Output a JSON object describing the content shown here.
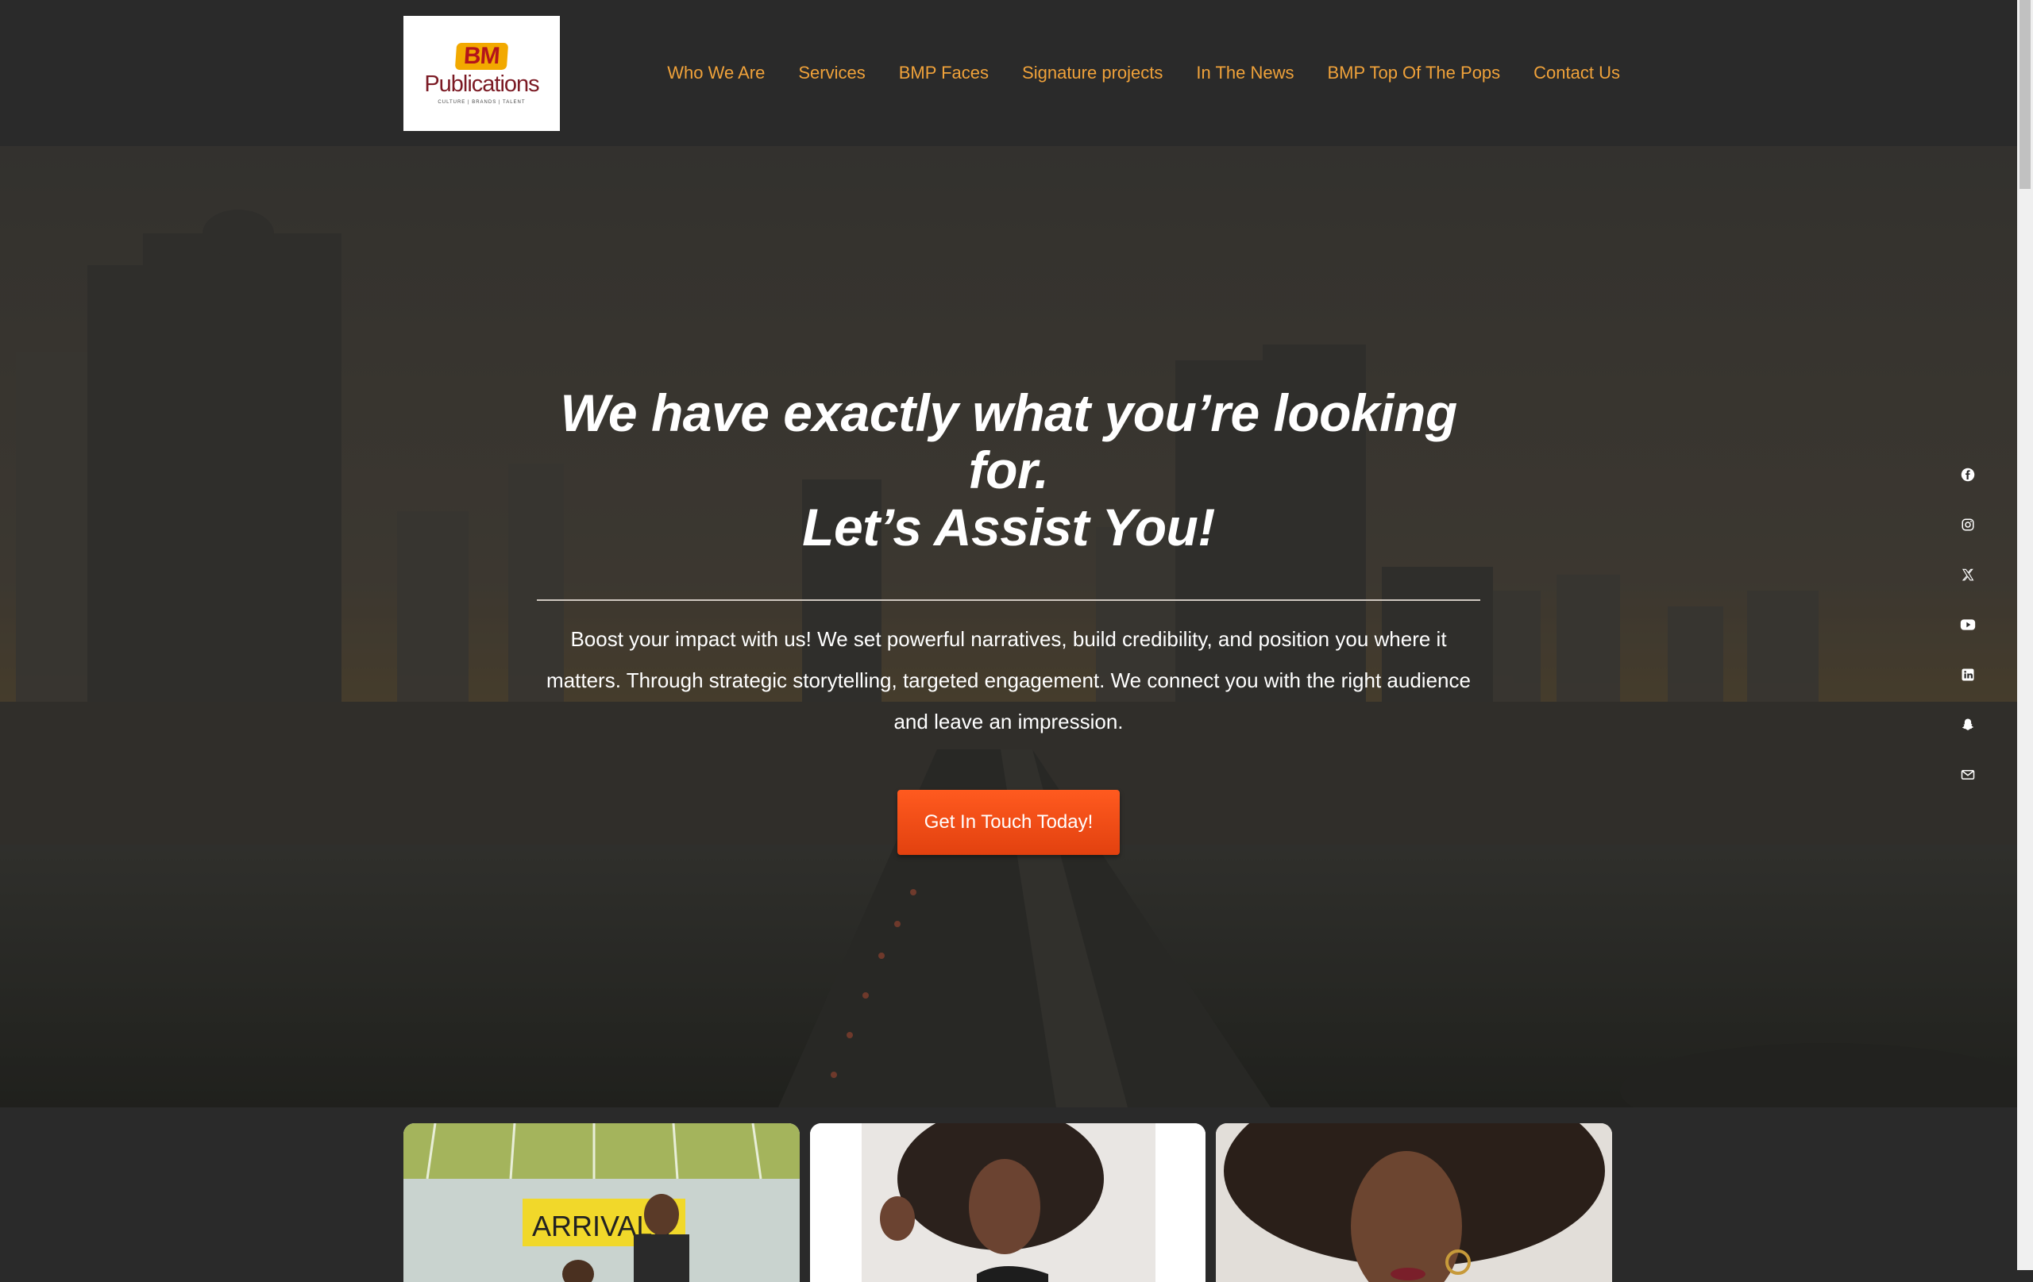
{
  "logo": {
    "mark": "BM",
    "name": "Publications",
    "tagline": "CULTURE | BRANDS | TALENT"
  },
  "nav": {
    "items": [
      {
        "label": "Who We Are"
      },
      {
        "label": "Services"
      },
      {
        "label": "BMP Faces"
      },
      {
        "label": "Signature projects"
      },
      {
        "label": "In The News"
      },
      {
        "label": "BMP Top Of The Pops"
      },
      {
        "label": "Contact Us"
      }
    ]
  },
  "hero": {
    "title_line1": "We have exactly what you’re looking for.",
    "title_line2": "Let’s Assist You!",
    "text": "Boost your impact with us! We set powerful narratives, build credibility, and position you where it matters. Through strategic storytelling, targeted engagement. We connect you with the right audience and leave an impression.",
    "cta_label": "Get In Touch Today!"
  },
  "social": [
    "facebook-icon",
    "instagram-icon",
    "x-icon",
    "youtube-icon",
    "linkedin-icon",
    "snapchat-icon",
    "mail-icon"
  ],
  "cards": {
    "card1_sign": "ARRIVALS"
  },
  "colors": {
    "nav_link": "#f0a23a",
    "cta": "#f04e1a",
    "background": "#2a2a2a"
  }
}
